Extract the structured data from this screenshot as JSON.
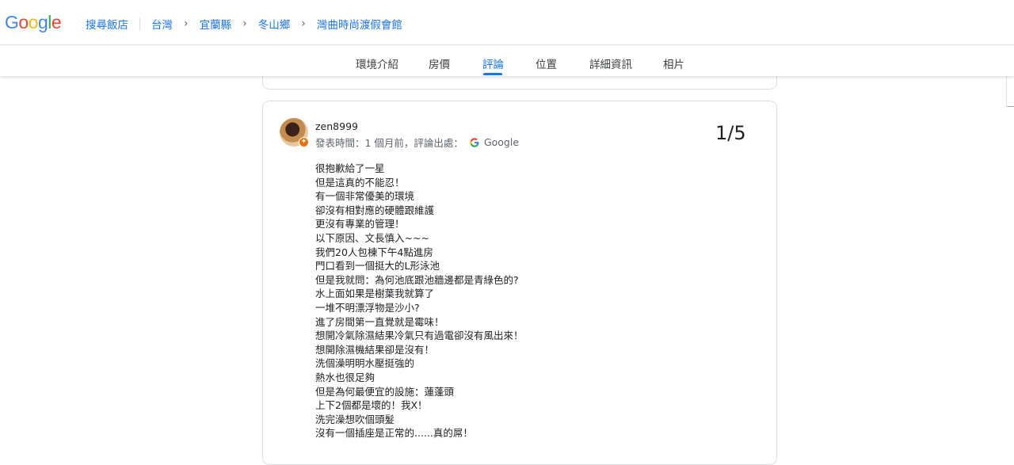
{
  "brand": {
    "logo_letters": [
      "G",
      "o",
      "o",
      "g",
      "l",
      "e"
    ]
  },
  "colors": {
    "blue": "#4285F4",
    "red": "#EA4335",
    "yellow": "#FBBC05",
    "green": "#34A853",
    "link": "#1a73e8"
  },
  "breadcrumb": {
    "hotel_search": "搜尋飯店",
    "items": [
      "台灣",
      "宜蘭縣",
      "冬山鄉",
      "灣曲時尚渡假會館"
    ]
  },
  "tabs": [
    {
      "label": "環境介紹"
    },
    {
      "label": "房價"
    },
    {
      "label": "評論"
    },
    {
      "label": "位置"
    },
    {
      "label": "詳細資訊"
    },
    {
      "label": "相片"
    }
  ],
  "active_tab": "評論",
  "review": {
    "reviewer": "zen8999",
    "meta_prefix": "發表時間：1 個月前，評論出處：",
    "source": "Google",
    "rating": "1/5",
    "lines": [
      "很抱歉給了一星",
      "但是這真的不能忍！",
      "有一個非常優美的環境",
      "卻沒有相對應的硬體跟維護",
      "更沒有專業的管理！",
      "以下原因、文長慎入~~~",
      "我們20人包棟下午4點進房",
      "門口看到一個挺大的L形泳池",
      "但是我就問：為何池底跟池牆邊都是青綠色的?",
      "水上面如果是樹葉我就算了",
      "一堆不明漂浮物是沙小?",
      "進了房間第一直覺就是霉味！",
      "想開冷氣除濕結果冷氣只有過電卻沒有風出來！",
      "想開除濕機結果卻是沒有！",
      "洗個澡明明水壓挺強的",
      "熱水也很足夠",
      "但是為何最便宜的設施：蓮蓬頭",
      "上下2個都是壞的！我X！",
      "洗完澡想吹個頭髮",
      "沒有一個插座是正常的......真的屌！"
    ]
  }
}
